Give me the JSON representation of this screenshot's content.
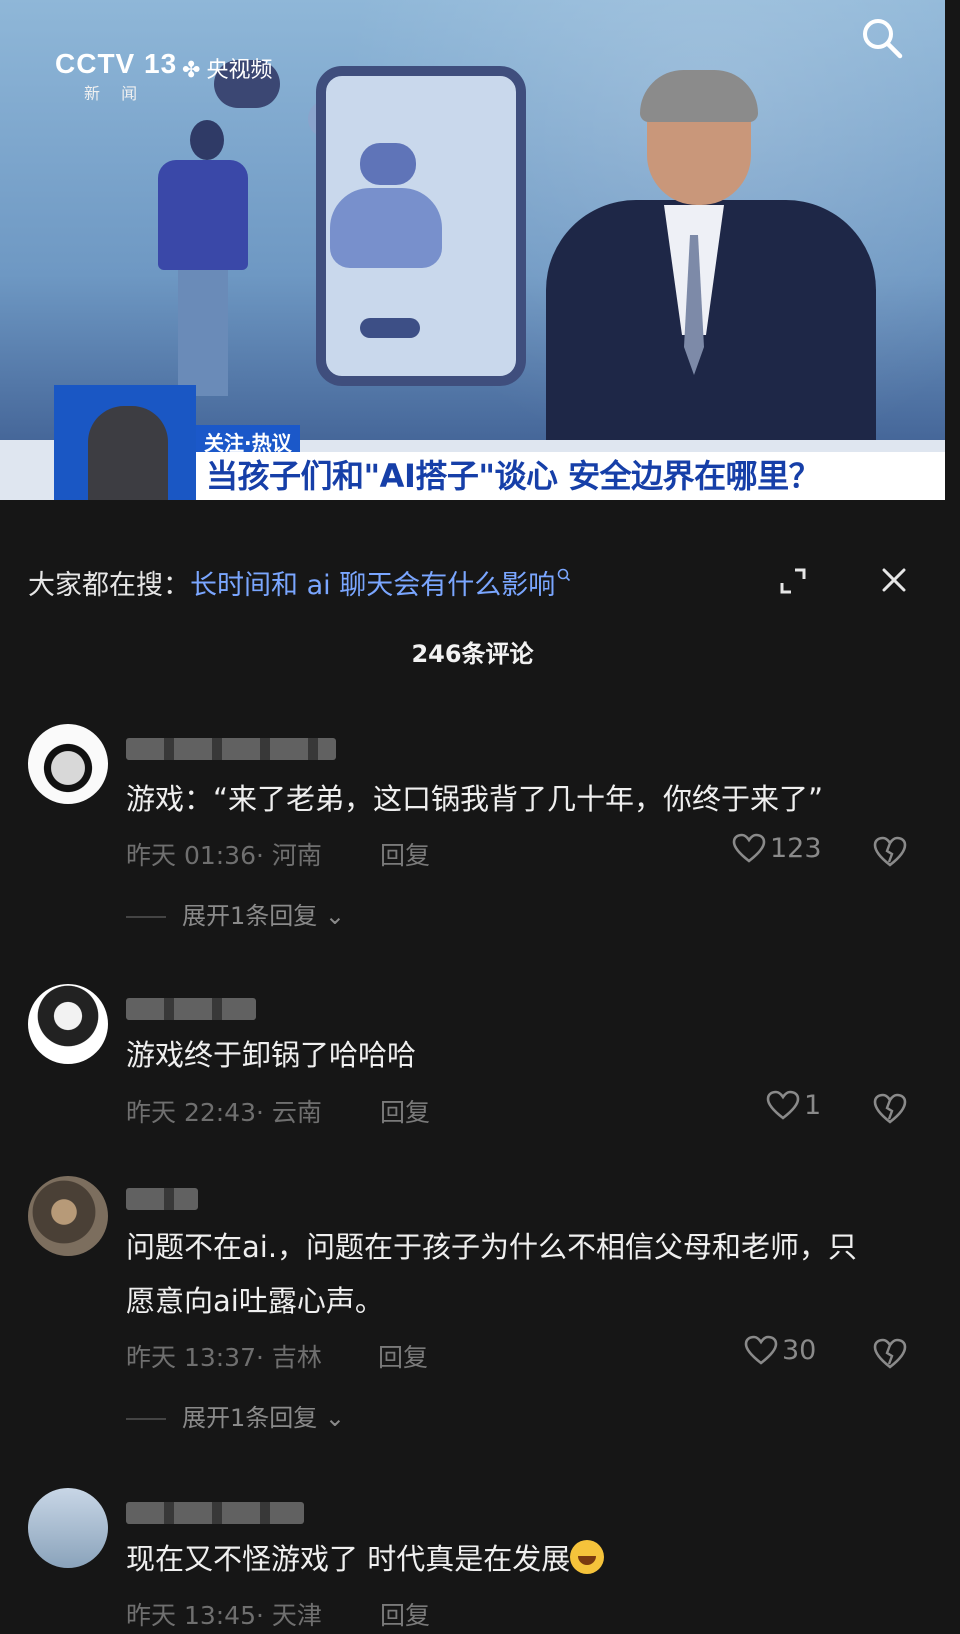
{
  "video": {
    "channel_logo": "CCTV 13",
    "channel_sub": "新 闻",
    "app_logo": "央视频",
    "tag": "关注·热议",
    "headline": "当孩子们和\"AI搭子\"谈心 安全边界在哪里？"
  },
  "search": {
    "label": "大家都在搜：",
    "query": "长时间和 ai 聊天会有什么影响"
  },
  "comments_count": "246条评论",
  "comments": [
    {
      "text": "游戏：“来了老弟，这口锅我背了几十年，你终于来了”",
      "meta": "昨天 01:36· 河南",
      "reply": "回复",
      "likes": "123",
      "expand": "展开1条回复"
    },
    {
      "text": "游戏终于卸锅了哈哈哈",
      "meta": "昨天 22:43· 云南",
      "reply": "回复",
      "likes": "1"
    },
    {
      "text": "问题不在ai.，问题在于孩子为什么不相信父母和老师，只愿意向ai吐露心声。",
      "meta": "昨天 13:37· 吉林",
      "reply": "回复",
      "likes": "30",
      "expand": "展开1条回复"
    },
    {
      "text": "现在又不怪游戏了 时代真是在发展",
      "meta": "昨天 13:45· 天津",
      "reply": "回复"
    }
  ],
  "colors": {
    "background": "#161616",
    "link_blue": "#7aa6ff",
    "headline_blue": "#163fa8",
    "tag_blue": "#1b58c9"
  }
}
